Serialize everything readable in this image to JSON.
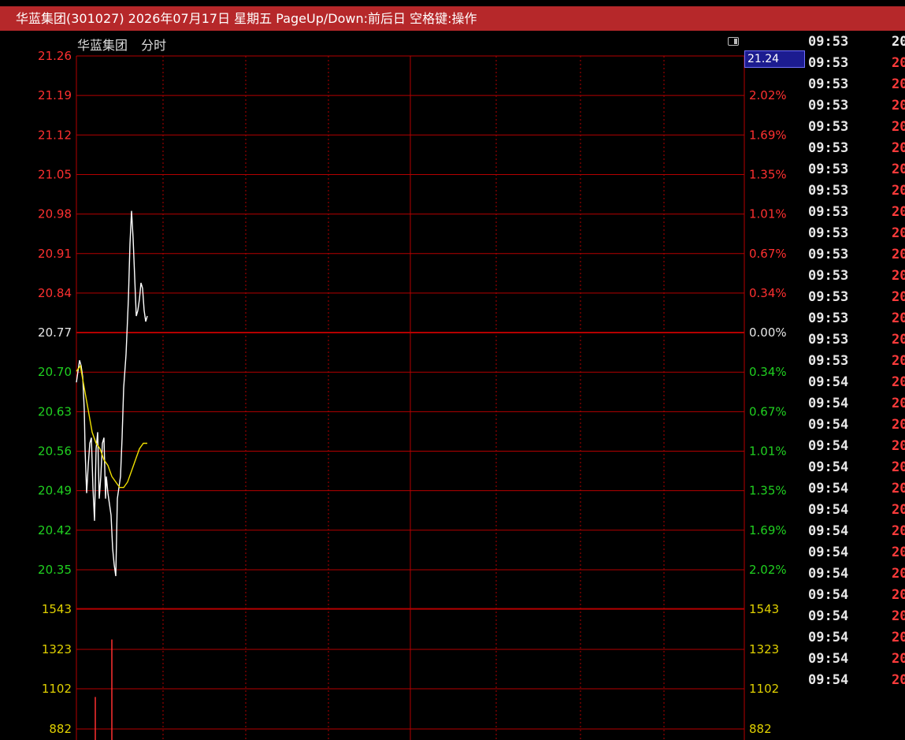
{
  "window": {
    "title": "华蓝集团(301027) 2026年07月17日 星期五 PageUp/Down:前后日 空格键:操作"
  },
  "chart_header": {
    "stock_name": "华蓝集团",
    "mode": "分时"
  },
  "current_price_tag": "21.24",
  "colors": {
    "grid": "#b40000",
    "up": "#ff3030",
    "down": "#20d020",
    "flat": "#e6e6e6",
    "price_line": "#ffffff",
    "avg_line": "#f0e000",
    "volume": "#ff3030",
    "volume_label": "#e0d000"
  },
  "chart_data": {
    "type": "line",
    "title": "",
    "xlabel": "",
    "ylabel": "",
    "ylim": [
      20.28,
      21.26
    ],
    "prev_close": 20.77,
    "price_ticks": [
      "21.26",
      "21.19",
      "21.12",
      "21.05",
      "20.98",
      "20.91",
      "20.84",
      "20.77",
      "20.70",
      "20.63",
      "20.56",
      "20.49",
      "20.42",
      "20.35"
    ],
    "percent_ticks": [
      "2.02%",
      "1.69%",
      "1.35%",
      "1.01%",
      "0.67%",
      "0.34%",
      "0.00%",
      "0.34%",
      "0.67%",
      "1.01%",
      "1.35%",
      "1.69%",
      "2.02%"
    ],
    "volume_ticks": [
      "1543",
      "1323",
      "1102",
      "882"
    ],
    "series": [
      {
        "x": [
          0,
          0.2,
          0.4,
          0.6,
          0.8,
          1.0,
          1.1,
          1.3,
          1.5,
          1.7,
          1.9,
          2.1,
          2.3,
          2.5,
          2.7,
          2.9,
          3.1,
          3.3,
          3.5,
          3.7,
          3.8,
          4.0,
          4.2,
          4.4,
          4.5,
          4.6,
          4.8,
          5.0,
          5.2,
          5.4,
          5.6,
          5.8,
          6.0,
          6.3,
          6.6,
          6.8,
          7.0,
          7.2,
          7.4,
          7.6,
          7.8,
          8.0,
          8.2,
          8.4,
          8.6,
          8.8,
          9.0
        ],
        "values": [
          20.67,
          20.69,
          20.71,
          20.7,
          20.68,
          20.62,
          20.55,
          20.47,
          20.52,
          20.56,
          20.57,
          20.48,
          20.42,
          20.55,
          20.58,
          20.46,
          20.5,
          20.56,
          20.57,
          20.46,
          20.5,
          20.47,
          20.45,
          20.43,
          20.4,
          20.37,
          20.34,
          20.32,
          20.46,
          20.48,
          20.5,
          20.57,
          20.66,
          20.72,
          20.82,
          20.92,
          20.98,
          20.93,
          20.86,
          20.79,
          20.8,
          20.82,
          20.85,
          20.84,
          20.8,
          20.78,
          20.79
        ]
      },
      {
        "x": [
          0,
          0.5,
          1.0,
          1.5,
          2.0,
          2.5,
          3.0,
          3.5,
          4.0,
          4.5,
          5.0,
          5.5,
          6.0,
          6.5,
          7.0,
          7.5,
          8.0,
          8.5,
          9.0
        ],
        "values": [
          20.69,
          20.7,
          20.66,
          20.62,
          20.58,
          20.56,
          20.55,
          20.53,
          20.52,
          20.5,
          20.49,
          20.48,
          20.48,
          20.49,
          20.51,
          20.53,
          20.55,
          20.56,
          20.56
        ]
      }
    ],
    "volume": {
      "ylim": [
        700,
        1543
      ],
      "x": [
        2.4,
        4.5
      ],
      "values": [
        1100,
        1390
      ]
    }
  },
  "ticks": [
    {
      "time": "09:53",
      "price": "20"
    },
    {
      "time": "09:53",
      "price": "20"
    },
    {
      "time": "09:53",
      "price": "20"
    },
    {
      "time": "09:53",
      "price": "20"
    },
    {
      "time": "09:53",
      "price": "20"
    },
    {
      "time": "09:53",
      "price": "20"
    },
    {
      "time": "09:53",
      "price": "20"
    },
    {
      "time": "09:53",
      "price": "20"
    },
    {
      "time": "09:53",
      "price": "20"
    },
    {
      "time": "09:53",
      "price": "20"
    },
    {
      "time": "09:53",
      "price": "20"
    },
    {
      "time": "09:53",
      "price": "20"
    },
    {
      "time": "09:53",
      "price": "20"
    },
    {
      "time": "09:53",
      "price": "20"
    },
    {
      "time": "09:53",
      "price": "20"
    },
    {
      "time": "09:53",
      "price": "20"
    },
    {
      "time": "09:54",
      "price": "20"
    },
    {
      "time": "09:54",
      "price": "20"
    },
    {
      "time": "09:54",
      "price": "20"
    },
    {
      "time": "09:54",
      "price": "20"
    },
    {
      "time": "09:54",
      "price": "20"
    },
    {
      "time": "09:54",
      "price": "20"
    },
    {
      "time": "09:54",
      "price": "20"
    },
    {
      "time": "09:54",
      "price": "20"
    },
    {
      "time": "09:54",
      "price": "20"
    },
    {
      "time": "09:54",
      "price": "20"
    },
    {
      "time": "09:54",
      "price": "20"
    },
    {
      "time": "09:54",
      "price": "20"
    },
    {
      "time": "09:54",
      "price": "20"
    },
    {
      "time": "09:54",
      "price": "20"
    },
    {
      "time": "09:54",
      "price": "20"
    }
  ]
}
